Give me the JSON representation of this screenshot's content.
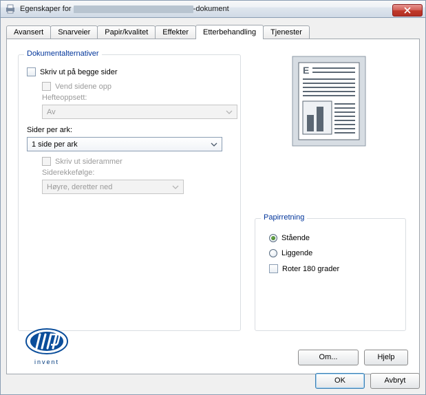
{
  "window": {
    "title_prefix": "Egenskaper for",
    "title_suffix": "-dokument"
  },
  "tabs": {
    "advanced": "Avansert",
    "shortcuts": "Snarveier",
    "paper": "Papir/kvalitet",
    "effects": "Effekter",
    "finishing": "Etterbehandling",
    "services": "Tjenester"
  },
  "doc": {
    "legend": "Dokumentalternativer",
    "both_sides": "Skriv ut på begge sider",
    "flip_up": "Vend sidene opp",
    "booklet_label": "Hefteoppsett:",
    "booklet_value": "Av",
    "pps_label": "Sider per ark:",
    "pps_value": "1 side per ark",
    "borders": "Skriv ut siderammer",
    "order_label": "Siderekkefølge:",
    "order_value": "Høyre, deretter ned"
  },
  "orient": {
    "legend": "Papirretning",
    "portrait": "Stående",
    "landscape": "Liggende",
    "rotate": "Roter 180 grader"
  },
  "buttons": {
    "about": "Om...",
    "help": "Hjelp",
    "ok": "OK",
    "cancel": "Avbryt"
  },
  "hp": {
    "invent": "invent"
  }
}
